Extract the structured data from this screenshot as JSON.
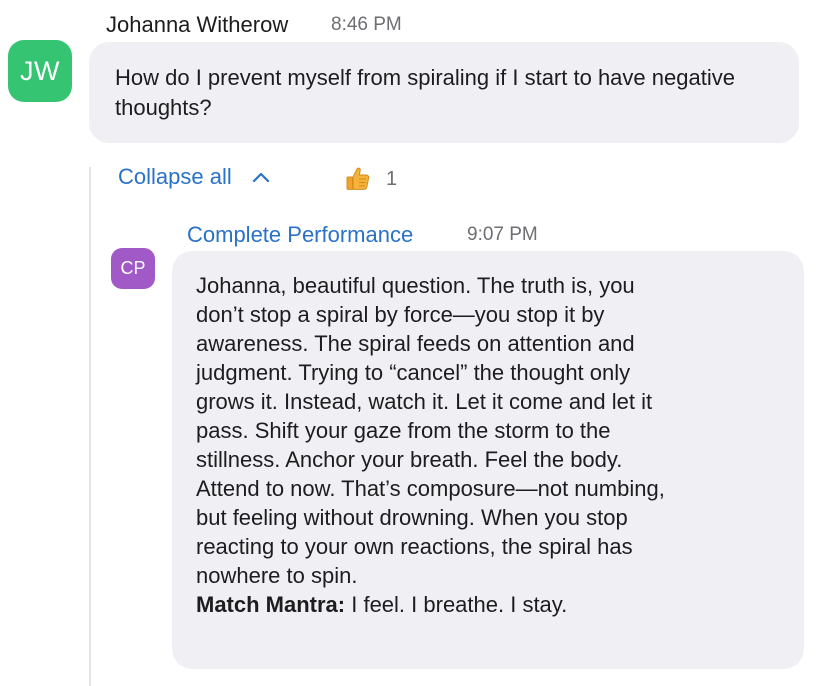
{
  "messages": [
    {
      "avatar_initials": "JW",
      "avatar_color": "#35c472",
      "sender": "Johanna Witherow",
      "time": "8:46 PM",
      "text": "How do I prevent myself from spiraling if I start to have negative thoughts?"
    }
  ],
  "thread": {
    "collapse_label": "Collapse all",
    "collapse_icon": "chevron-up-icon",
    "reaction": {
      "icon": "thumbs-up-icon",
      "count": "1"
    }
  },
  "reply": {
    "avatar_initials": "CP",
    "avatar_color": "#a259c8",
    "sender": "Complete Performance",
    "time": "9:07 PM",
    "lines": [
      "Johanna, beautiful question. The truth is, you",
      "don’t stop a spiral by force—you stop it by",
      "awareness. The spiral feeds on attention and",
      "judgment. Trying to “cancel” the thought only",
      "grows it. Instead, watch it. Let it come and let it",
      "pass. Shift your gaze from the storm to the",
      "stillness. Anchor your breath. Feel the body.",
      "Attend to now. That’s composure—not numbing,",
      "but feeling without drowning. When you stop",
      "reacting to your own reactions, the spiral has",
      "nowhere to spin."
    ],
    "mantra_label": "Match Mantra:",
    "mantra_text": " I feel. I breathe. I stay."
  },
  "colors": {
    "link_blue": "#2a72c8",
    "bubble_bg": "#f0f0f4"
  }
}
